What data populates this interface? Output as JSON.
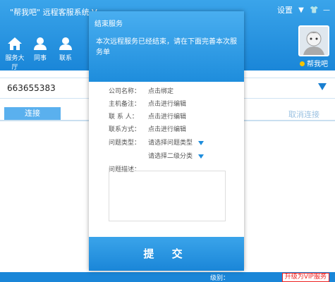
{
  "app": {
    "title": "\"帮我吧\" 远程客服系统 V",
    "settings_label": "设置",
    "help_link": "帮我吧"
  },
  "nav": {
    "items": [
      {
        "label": "服务大厅",
        "icon": "home-icon"
      },
      {
        "label": "同事",
        "icon": "user-icon"
      },
      {
        "label": "联系",
        "icon": "contacts-icon"
      }
    ]
  },
  "id_bar": {
    "value": "663655383"
  },
  "tabs": {
    "connect": "连接",
    "cancel": "取消连接"
  },
  "status_bar": {
    "level": "级别：",
    "vip": "升级为VIP服务"
  },
  "modal": {
    "title": "结束服务",
    "message": "本次远程服务已经结束，请在下面完善本次服务单",
    "fields": [
      {
        "label": "公司名称：",
        "value": "点击绑定"
      },
      {
        "label": "主机备注：",
        "value": "点击进行编辑"
      },
      {
        "label": "联 系 人：",
        "value": "点击进行编辑"
      },
      {
        "label": "联系方式：",
        "value": "点击进行编辑"
      }
    ],
    "issue_type": {
      "label": "问题类型：",
      "value": "请选择问题类型"
    },
    "issue_subtype": {
      "value": "请选择二级分类"
    },
    "description_label": "问题描述：",
    "submit_label": "提 交"
  },
  "colors": {
    "primary": "#1a86d8",
    "accent_light": "#5ab0ee",
    "vip_red": "#e22222"
  }
}
